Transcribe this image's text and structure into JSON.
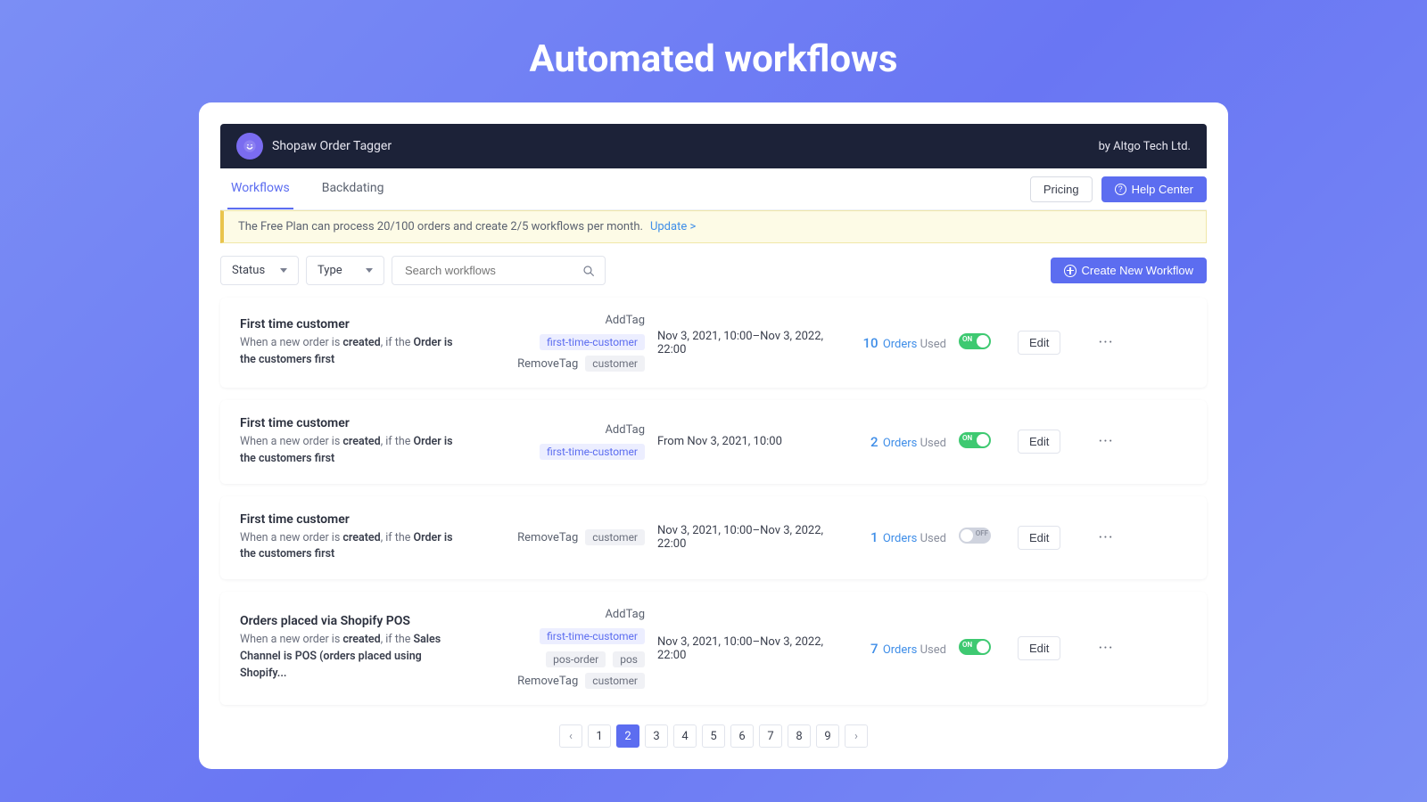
{
  "outer_title": "Automated workflows",
  "app": {
    "name": "Shopaw Order Tagger",
    "by": "by Altgo Tech Ltd."
  },
  "tabs": {
    "workflows": "Workflows",
    "backdating": "Backdating"
  },
  "buttons": {
    "pricing": "Pricing",
    "help_center": "Help Center",
    "create_workflow": "Create New Workflow",
    "edit": "Edit"
  },
  "notice": {
    "text": "The Free Plan can process 20/100 orders and create 2/5 workflows per month.",
    "link": "Update >"
  },
  "filters": {
    "status_label": "Status",
    "type_label": "Type",
    "search_placeholder": "Search workflows"
  },
  "tag_labels": {
    "add": "AddTag",
    "remove": "RemoveTag"
  },
  "toggle_labels": {
    "on": "ON",
    "off": "OFF"
  },
  "orders_words": {
    "orders": "Orders",
    "used": "Used"
  },
  "workflows": [
    {
      "title": "First time customer",
      "desc_parts": [
        "When a new order is ",
        "created",
        ", if the ",
        "Order is the customers first",
        ""
      ],
      "add_tags": [
        "first-time-customer"
      ],
      "add_tags_grey": [],
      "remove_tags": [
        "customer"
      ],
      "date": "Nov 3, 2021, 10:00–Nov 3, 2022, 22:00",
      "orders_count": "10",
      "on": true
    },
    {
      "title": "First time customer",
      "desc_parts": [
        "When a new order is ",
        "created",
        ", if the ",
        "Order is the customers first",
        ""
      ],
      "add_tags": [
        "first-time-customer"
      ],
      "add_tags_grey": [],
      "remove_tags": [],
      "date": "From Nov 3, 2021, 10:00",
      "orders_count": "2",
      "on": true
    },
    {
      "title": "First time customer",
      "desc_parts": [
        "When a new order is ",
        "created",
        ", if the ",
        "Order is the customers first",
        ""
      ],
      "add_tags": [],
      "add_tags_grey": [],
      "remove_tags": [
        "customer"
      ],
      "date": "Nov 3, 2021, 10:00–Nov 3, 2022, 22:00",
      "orders_count": "1",
      "on": false
    },
    {
      "title": "Orders placed via Shopify POS",
      "desc_parts": [
        "When a new order is ",
        "created",
        ", if the ",
        "Sales Channel is POS (orders placed using Shopify...",
        ""
      ],
      "add_tags": [
        "first-time-customer"
      ],
      "add_tags_grey": [
        "pos-order",
        "pos"
      ],
      "remove_tags": [
        "customer"
      ],
      "date": "Nov 3, 2021, 10:00–Nov 3, 2022, 22:00",
      "orders_count": "7",
      "on": true
    }
  ],
  "pagination": {
    "pages": [
      "1",
      "2",
      "3",
      "4",
      "5",
      "6",
      "7",
      "8",
      "9"
    ],
    "active": "2"
  }
}
